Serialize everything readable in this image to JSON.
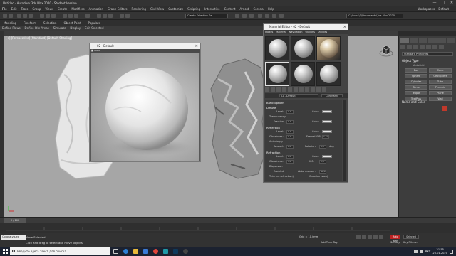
{
  "window": {
    "title": "Untitled - Autodesk 3ds Max 2020 - Student Version",
    "controls": [
      "—",
      "□",
      "✕"
    ]
  },
  "menu": {
    "items": [
      "File",
      "Edit",
      "Tools",
      "Group",
      "Views",
      "Create",
      "Modifiers",
      "Animation",
      "Graph Editors",
      "Rendering",
      "Civil View",
      "Customize",
      "Scripting",
      "Interactive",
      "Content",
      "Arnold",
      "Corona",
      "Help"
    ],
    "workspaces_label": "Workspaces:",
    "workspace_value": "Default"
  },
  "toolbar": {
    "selection_set": "Create Selection Se",
    "project_path": "C:\\Users\\1\\Documents\\3ds Max 2020"
  },
  "ribbon": {
    "tabs": [
      "Modeling",
      "Freeform",
      "Selection",
      "Object Paint",
      "Populate"
    ],
    "subtabs": [
      "Define Flows",
      "Define Idle Areas",
      "Simulate",
      "Display",
      "Edit Selected"
    ]
  },
  "viewport": {
    "label": "[+] [Perspective] [Standard] [Default Shading]"
  },
  "render_window": {
    "title": "02 - Default",
    "bar_label": "■ Auto"
  },
  "material_editor": {
    "title": "Material Editor - 02 - Default",
    "menu": [
      "Modes",
      "Material",
      "Navigation",
      "Options",
      "Utilities"
    ],
    "material_name": "02 - Default",
    "material_type": "CoronaMtl",
    "sections": {
      "basic": "Basic options",
      "diffuse": "Diffuse",
      "reflection": "Reflection",
      "refraction": "Refraction"
    },
    "labels": {
      "level": "Level:",
      "color": "Color:",
      "translucency": "Translucency",
      "fraction": "Fraction:",
      "glossiness": "Glossiness:",
      "fresnel": "Fresnel IOR:",
      "anisotropy": "Anisotropy",
      "amount": "Amount:",
      "rotation": "Rotation:",
      "deg": "deg",
      "ior": "IOR:",
      "dispersion": "Dispersion",
      "enabled": "Enabled",
      "abbe": "Abbe number:",
      "thin": "Thin (no refraction)",
      "caustics": "Caustics (slow)"
    },
    "values": {
      "diffuse_level": "1,0",
      "fraction": "0,0",
      "refl_level": "0,0",
      "gloss": "1,0",
      "fresnel": "1,52",
      "amount": "0,0",
      "rotation": "0,0",
      "refr_level": "0,0",
      "ior": "1,0",
      "refr_gloss": "1,0",
      "abbe": "40,0"
    }
  },
  "command_panel": {
    "category": "Standard Primitives",
    "object_type": "Object Type",
    "autogrid": "AutoGrid",
    "buttons": [
      "Box",
      "Cone",
      "Sphere",
      "GeoSphere",
      "Cylinder",
      "Tube",
      "Torus",
      "Pyramid",
      "Teapot",
      "Plane",
      "TextPlus",
      "Wall"
    ],
    "name_color": "Name and Color",
    "accent_color": "#c0392b"
  },
  "timeline": {
    "position": "0 / 100"
  },
  "status": {
    "maxscript": "Corona.vis.ex",
    "selected": "None Selected",
    "hint": "Click and drag to select and move objects",
    "coords": "Grid = 10,0mm",
    "add_time_tag": "Add Time Tag",
    "auto_key": "Auto Key",
    "selected_dd": "Selected",
    "set_key": "Set Key",
    "key_filters": "Key Filters..."
  },
  "taskbar": {
    "search": "Введите здесь текст для поиска",
    "lang": "РУС",
    "time": "21:55",
    "date": "25.01.2020"
  }
}
